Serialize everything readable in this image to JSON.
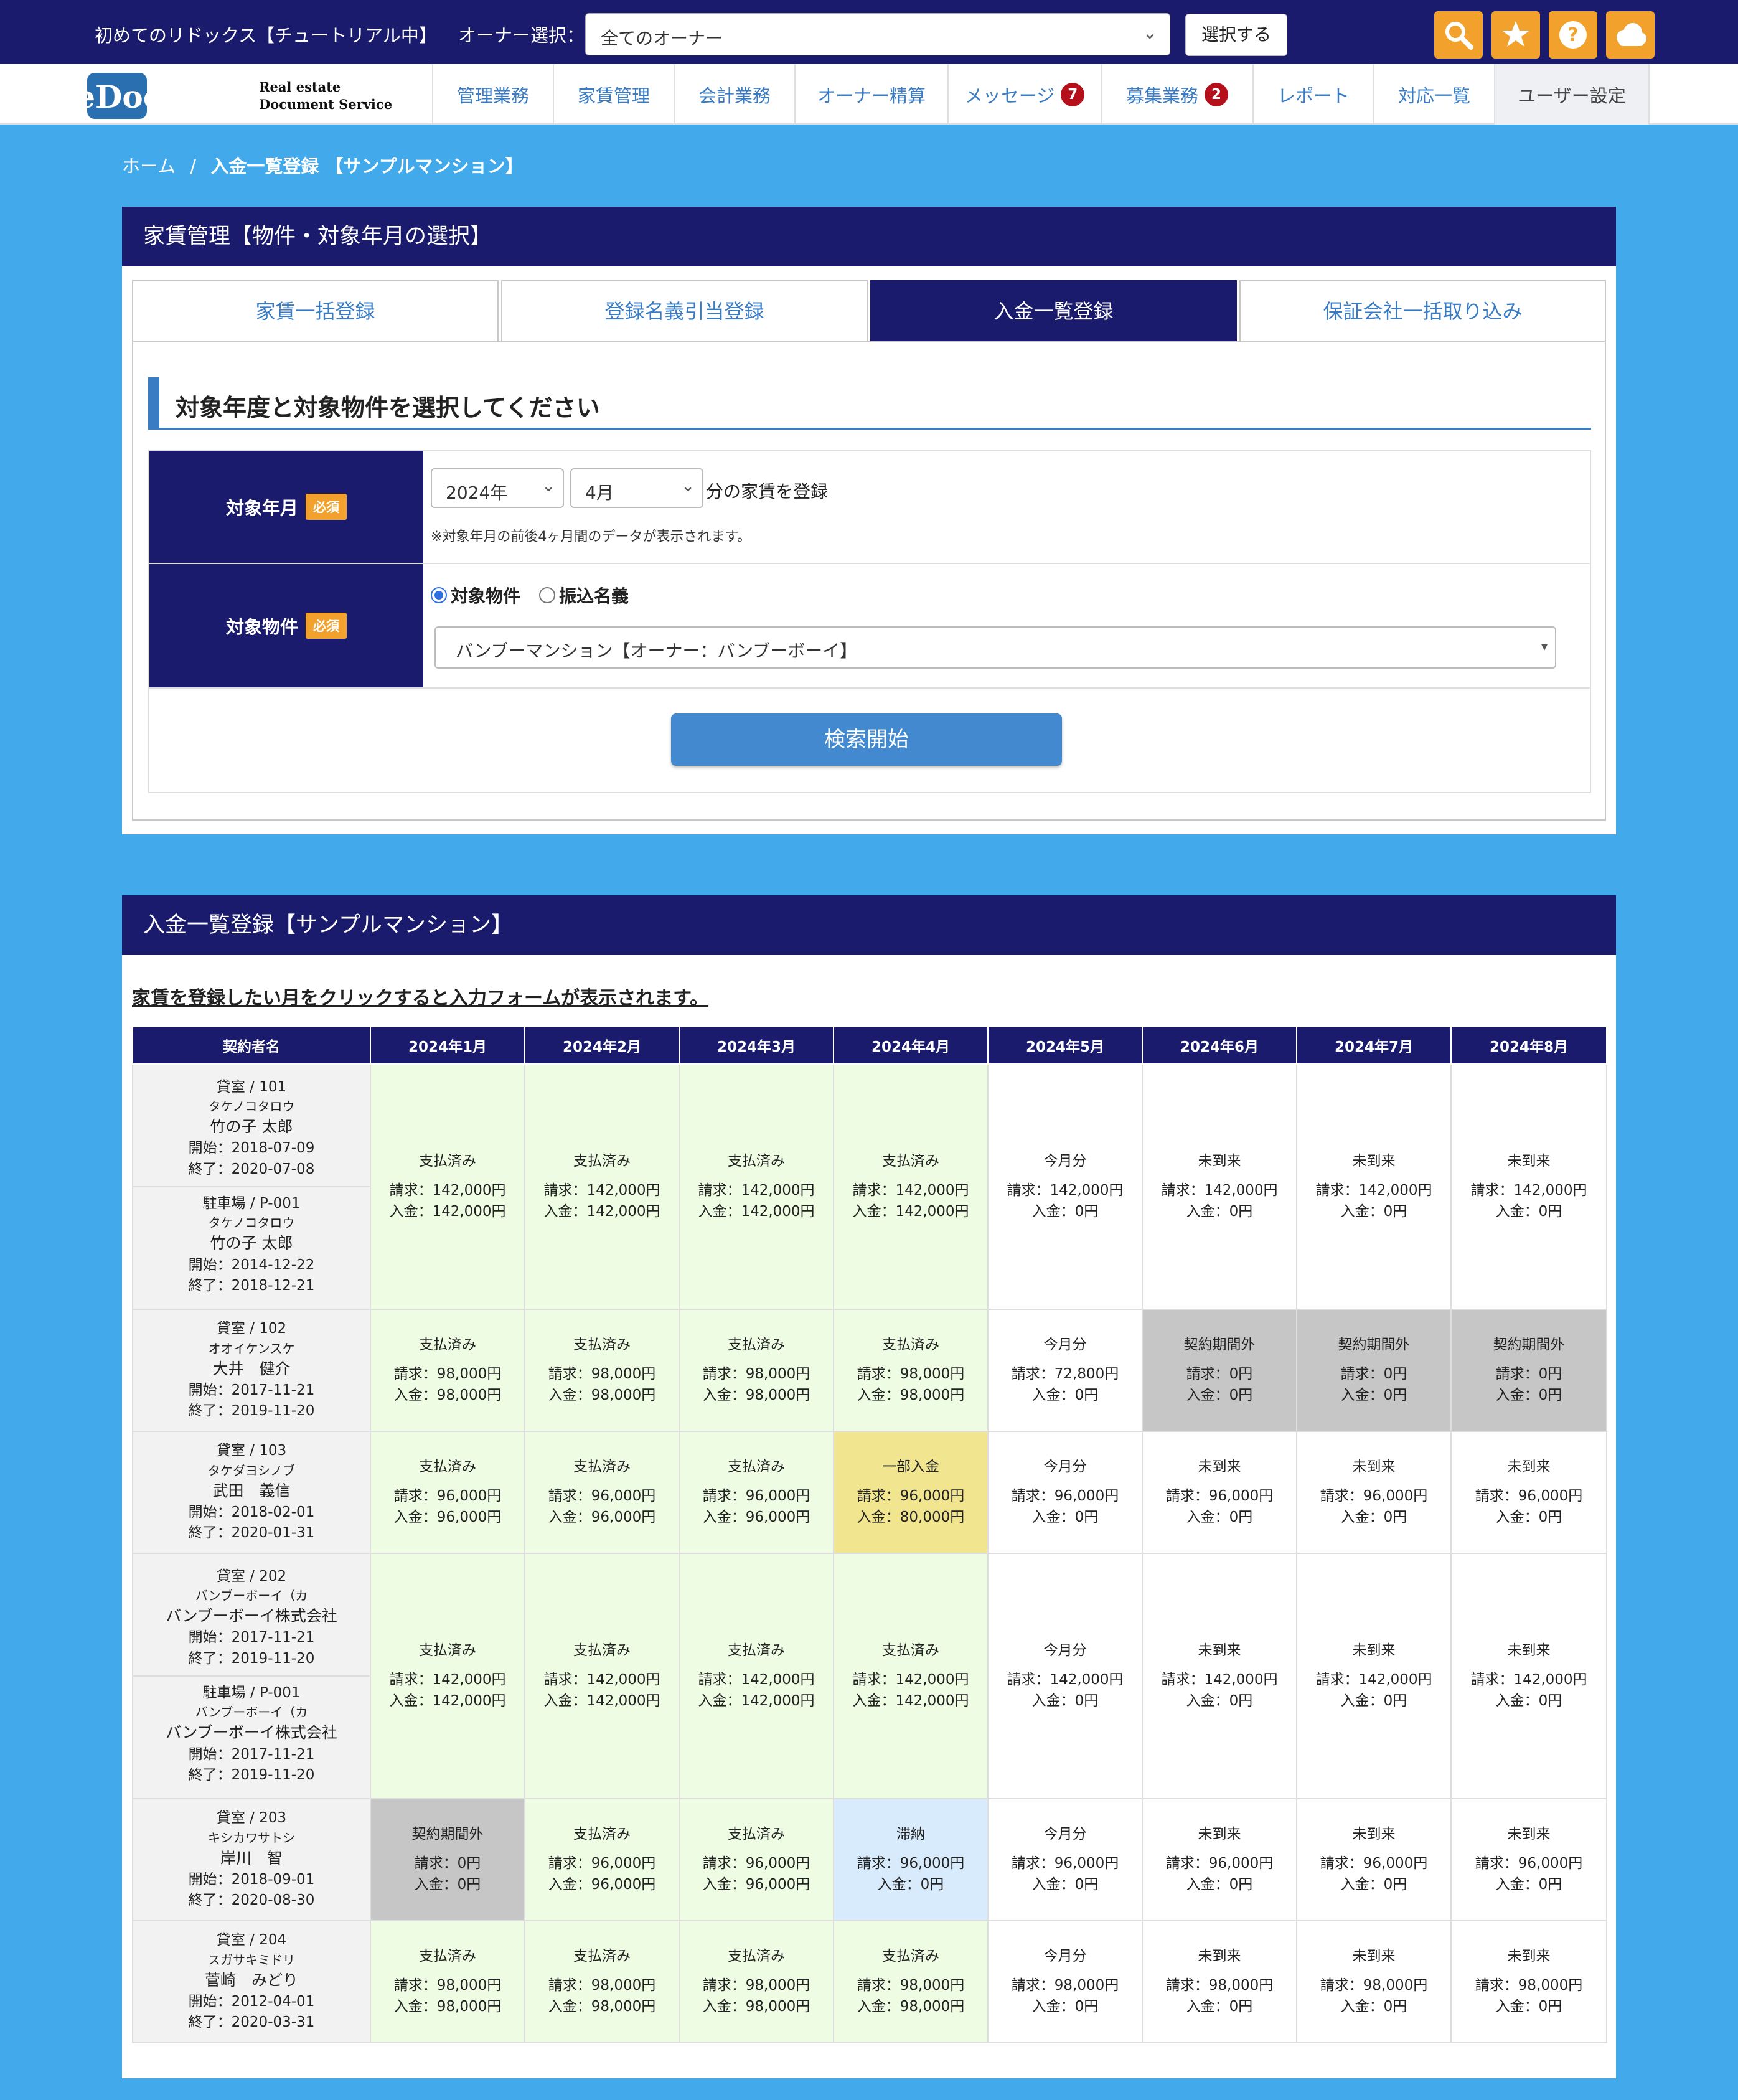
{
  "topbar": {
    "app_title": "初めてのリドックス【チュートリアル中】",
    "owner_label": "オーナー選択：",
    "owner_value": "全てのオーナー",
    "select_button": "選択する",
    "icons": [
      "search-icon",
      "star-icon",
      "help-icon",
      "cloud-icon"
    ],
    "accent": "#f2a22c"
  },
  "logo": {
    "mark": "ReDocS",
    "line1": "Real estate",
    "line2": "Document Service"
  },
  "nav": {
    "items": [
      {
        "label": "管理業務",
        "badge": ""
      },
      {
        "label": "家賃管理",
        "badge": ""
      },
      {
        "label": "会計業務",
        "badge": ""
      },
      {
        "label": "オーナー精算",
        "badge": ""
      },
      {
        "label": "メッセージ",
        "badge": "7"
      },
      {
        "label": "募集業務",
        "badge": "2"
      },
      {
        "label": "レポート",
        "badge": ""
      },
      {
        "label": "対応一覧",
        "badge": ""
      },
      {
        "label": "ユーザー設定",
        "badge": ""
      }
    ]
  },
  "breadcrumb": {
    "home": "ホーム",
    "sep": "/",
    "current": "入金一覧登録 【サンプルマンション】"
  },
  "selection_panel": {
    "title": "家賃管理【物件・対象年月の選択】",
    "tabs": [
      "家賃一括登録",
      "登録名義引当登録",
      "入金一覧登録",
      "保証会社一括取り込み"
    ],
    "active_tab": "入金一覧登録",
    "section_title": "対象年度と対象物件を選択してください",
    "required_badge": "必須",
    "year_month": {
      "label": "対象年月",
      "year": "2024年",
      "month": "4月",
      "suffix": "分の家賃を登録",
      "note": "※対象年月の前後4ヶ月間のデータが表示されます。"
    },
    "property": {
      "label": "対象物件",
      "radio1": "対象物件",
      "radio2": "振込名義",
      "selected_radio": "対象物件",
      "value": "バンブーマンション【オーナー：バンブーボーイ】"
    },
    "search_button": "検索開始"
  },
  "list_panel": {
    "title": "入金一覧登録【サンプルマンション】",
    "instruction": "家賃を登録したい月をクリックすると入力フォームが表示されます。",
    "header_name": "契約者名",
    "months": [
      "2024年1月",
      "2024年2月",
      "2024年3月",
      "2024年4月",
      "2024年5月",
      "2024年6月",
      "2024年7月",
      "2024年8月"
    ],
    "colors": {
      "paid": "#eefce3",
      "partial": "#f1e68f",
      "overdue": "#d8ebfd",
      "outside": "#c6c6c6",
      "header": "#1b1b6e"
    },
    "rows": [
      {
        "contracts": [
          {
            "unit": "貸室 / 101",
            "kana": "タケノコタロウ",
            "name": "竹の子 太郎",
            "start": "開始：2018-07-09",
            "end": "終了：2020-07-08"
          },
          {
            "unit": "駐車場 / P-001",
            "kana": "タケノコタロウ",
            "name": "竹の子 太郎",
            "start": "開始：2014-12-22",
            "end": "終了：2018-12-21"
          }
        ],
        "cells": [
          {
            "type": "paid",
            "status": "支払済み",
            "billed": "請求：142,000円",
            "received": "入金：142,000円"
          },
          {
            "type": "paid",
            "status": "支払済み",
            "billed": "請求：142,000円",
            "received": "入金：142,000円"
          },
          {
            "type": "paid",
            "status": "支払済み",
            "billed": "請求：142,000円",
            "received": "入金：142,000円"
          },
          {
            "type": "paid",
            "status": "支払済み",
            "billed": "請求：142,000円",
            "received": "入金：142,000円"
          },
          {
            "type": "now",
            "status": "今月分",
            "billed": "請求：142,000円",
            "received": "入金：0円"
          },
          {
            "type": "future",
            "status": "未到来",
            "billed": "請求：142,000円",
            "received": "入金：0円"
          },
          {
            "type": "future",
            "status": "未到来",
            "billed": "請求：142,000円",
            "received": "入金：0円"
          },
          {
            "type": "future",
            "status": "未到来",
            "billed": "請求：142,000円",
            "received": "入金：0円"
          }
        ]
      },
      {
        "contracts": [
          {
            "unit": "貸室 / 102",
            "kana": "オオイケンスケ",
            "name": "大井　健介",
            "start": "開始：2017-11-21",
            "end": "終了：2019-11-20"
          }
        ],
        "cells": [
          {
            "type": "paid",
            "status": "支払済み",
            "billed": "請求：98,000円",
            "received": "入金：98,000円"
          },
          {
            "type": "paid",
            "status": "支払済み",
            "billed": "請求：98,000円",
            "received": "入金：98,000円"
          },
          {
            "type": "paid",
            "status": "支払済み",
            "billed": "請求：98,000円",
            "received": "入金：98,000円"
          },
          {
            "type": "paid",
            "status": "支払済み",
            "billed": "請求：98,000円",
            "received": "入金：98,000円"
          },
          {
            "type": "now",
            "status": "今月分",
            "billed": "請求：72,800円",
            "received": "入金：0円"
          },
          {
            "type": "outside",
            "status": "契約期間外",
            "billed": "請求：0円",
            "received": "入金：0円"
          },
          {
            "type": "outside",
            "status": "契約期間外",
            "billed": "請求：0円",
            "received": "入金：0円"
          },
          {
            "type": "outside",
            "status": "契約期間外",
            "billed": "請求：0円",
            "received": "入金：0円"
          }
        ]
      },
      {
        "contracts": [
          {
            "unit": "貸室 / 103",
            "kana": "タケダヨシノブ",
            "name": "武田　義信",
            "start": "開始：2018-02-01",
            "end": "終了：2020-01-31"
          }
        ],
        "cells": [
          {
            "type": "paid",
            "status": "支払済み",
            "billed": "請求：96,000円",
            "received": "入金：96,000円"
          },
          {
            "type": "paid",
            "status": "支払済み",
            "billed": "請求：96,000円",
            "received": "入金：96,000円"
          },
          {
            "type": "paid",
            "status": "支払済み",
            "billed": "請求：96,000円",
            "received": "入金：96,000円"
          },
          {
            "type": "partial",
            "status": "一部入金",
            "billed": "請求：96,000円",
            "received": "入金：80,000円"
          },
          {
            "type": "now",
            "status": "今月分",
            "billed": "請求：96,000円",
            "received": "入金：0円"
          },
          {
            "type": "future",
            "status": "未到来",
            "billed": "請求：96,000円",
            "received": "入金：0円"
          },
          {
            "type": "future",
            "status": "未到来",
            "billed": "請求：96,000円",
            "received": "入金：0円"
          },
          {
            "type": "future",
            "status": "未到来",
            "billed": "請求：96,000円",
            "received": "入金：0円"
          }
        ]
      },
      {
        "contracts": [
          {
            "unit": "貸室 / 202",
            "kana": "バンブーボーイ（カ",
            "name": "バンブーボーイ株式会社",
            "start": "開始：2017-11-21",
            "end": "終了：2019-11-20"
          },
          {
            "unit": "駐車場 / P-001",
            "kana": "バンブーボーイ（カ",
            "name": "バンブーボーイ株式会社",
            "start": "開始：2017-11-21",
            "end": "終了：2019-11-20"
          }
        ],
        "cells": [
          {
            "type": "paid",
            "status": "支払済み",
            "billed": "請求：142,000円",
            "received": "入金：142,000円"
          },
          {
            "type": "paid",
            "status": "支払済み",
            "billed": "請求：142,000円",
            "received": "入金：142,000円"
          },
          {
            "type": "paid",
            "status": "支払済み",
            "billed": "請求：142,000円",
            "received": "入金：142,000円"
          },
          {
            "type": "paid",
            "status": "支払済み",
            "billed": "請求：142,000円",
            "received": "入金：142,000円"
          },
          {
            "type": "now",
            "status": "今月分",
            "billed": "請求：142,000円",
            "received": "入金：0円"
          },
          {
            "type": "future",
            "status": "未到来",
            "billed": "請求：142,000円",
            "received": "入金：0円"
          },
          {
            "type": "future",
            "status": "未到来",
            "billed": "請求：142,000円",
            "received": "入金：0円"
          },
          {
            "type": "future",
            "status": "未到来",
            "billed": "請求：142,000円",
            "received": "入金：0円"
          }
        ]
      },
      {
        "contracts": [
          {
            "unit": "貸室 / 203",
            "kana": "キシカワサトシ",
            "name": "岸川　智",
            "start": "開始：2018-09-01",
            "end": "終了：2020-08-30"
          }
        ],
        "cells": [
          {
            "type": "outside",
            "status": "契約期間外",
            "billed": "請求：0円",
            "received": "入金：0円"
          },
          {
            "type": "paid",
            "status": "支払済み",
            "billed": "請求：96,000円",
            "received": "入金：96,000円"
          },
          {
            "type": "paid",
            "status": "支払済み",
            "billed": "請求：96,000円",
            "received": "入金：96,000円"
          },
          {
            "type": "overdue",
            "status": "滞納",
            "billed": "請求：96,000円",
            "received": "入金：0円"
          },
          {
            "type": "now",
            "status": "今月分",
            "billed": "請求：96,000円",
            "received": "入金：0円"
          },
          {
            "type": "future",
            "status": "未到来",
            "billed": "請求：96,000円",
            "received": "入金：0円"
          },
          {
            "type": "future",
            "status": "未到来",
            "billed": "請求：96,000円",
            "received": "入金：0円"
          },
          {
            "type": "future",
            "status": "未到来",
            "billed": "請求：96,000円",
            "received": "入金：0円"
          }
        ]
      },
      {
        "contracts": [
          {
            "unit": "貸室 / 204",
            "kana": "スガサキミドリ",
            "name": "菅崎　みどり",
            "start": "開始：2012-04-01",
            "end": "終了：2020-03-31"
          }
        ],
        "cells": [
          {
            "type": "paid",
            "status": "支払済み",
            "billed": "請求：98,000円",
            "received": "入金：98,000円"
          },
          {
            "type": "paid",
            "status": "支払済み",
            "billed": "請求：98,000円",
            "received": "入金：98,000円"
          },
          {
            "type": "paid",
            "status": "支払済み",
            "billed": "請求：98,000円",
            "received": "入金：98,000円"
          },
          {
            "type": "paid",
            "status": "支払済み",
            "billed": "請求：98,000円",
            "received": "入金：98,000円"
          },
          {
            "type": "now",
            "status": "今月分",
            "billed": "請求：98,000円",
            "received": "入金：0円"
          },
          {
            "type": "future",
            "status": "未到来",
            "billed": "請求：98,000円",
            "received": "入金：0円"
          },
          {
            "type": "future",
            "status": "未到来",
            "billed": "請求：98,000円",
            "received": "入金：0円"
          },
          {
            "type": "future",
            "status": "未到来",
            "billed": "請求：98,000円",
            "received": "入金：0円"
          }
        ]
      }
    ]
  }
}
